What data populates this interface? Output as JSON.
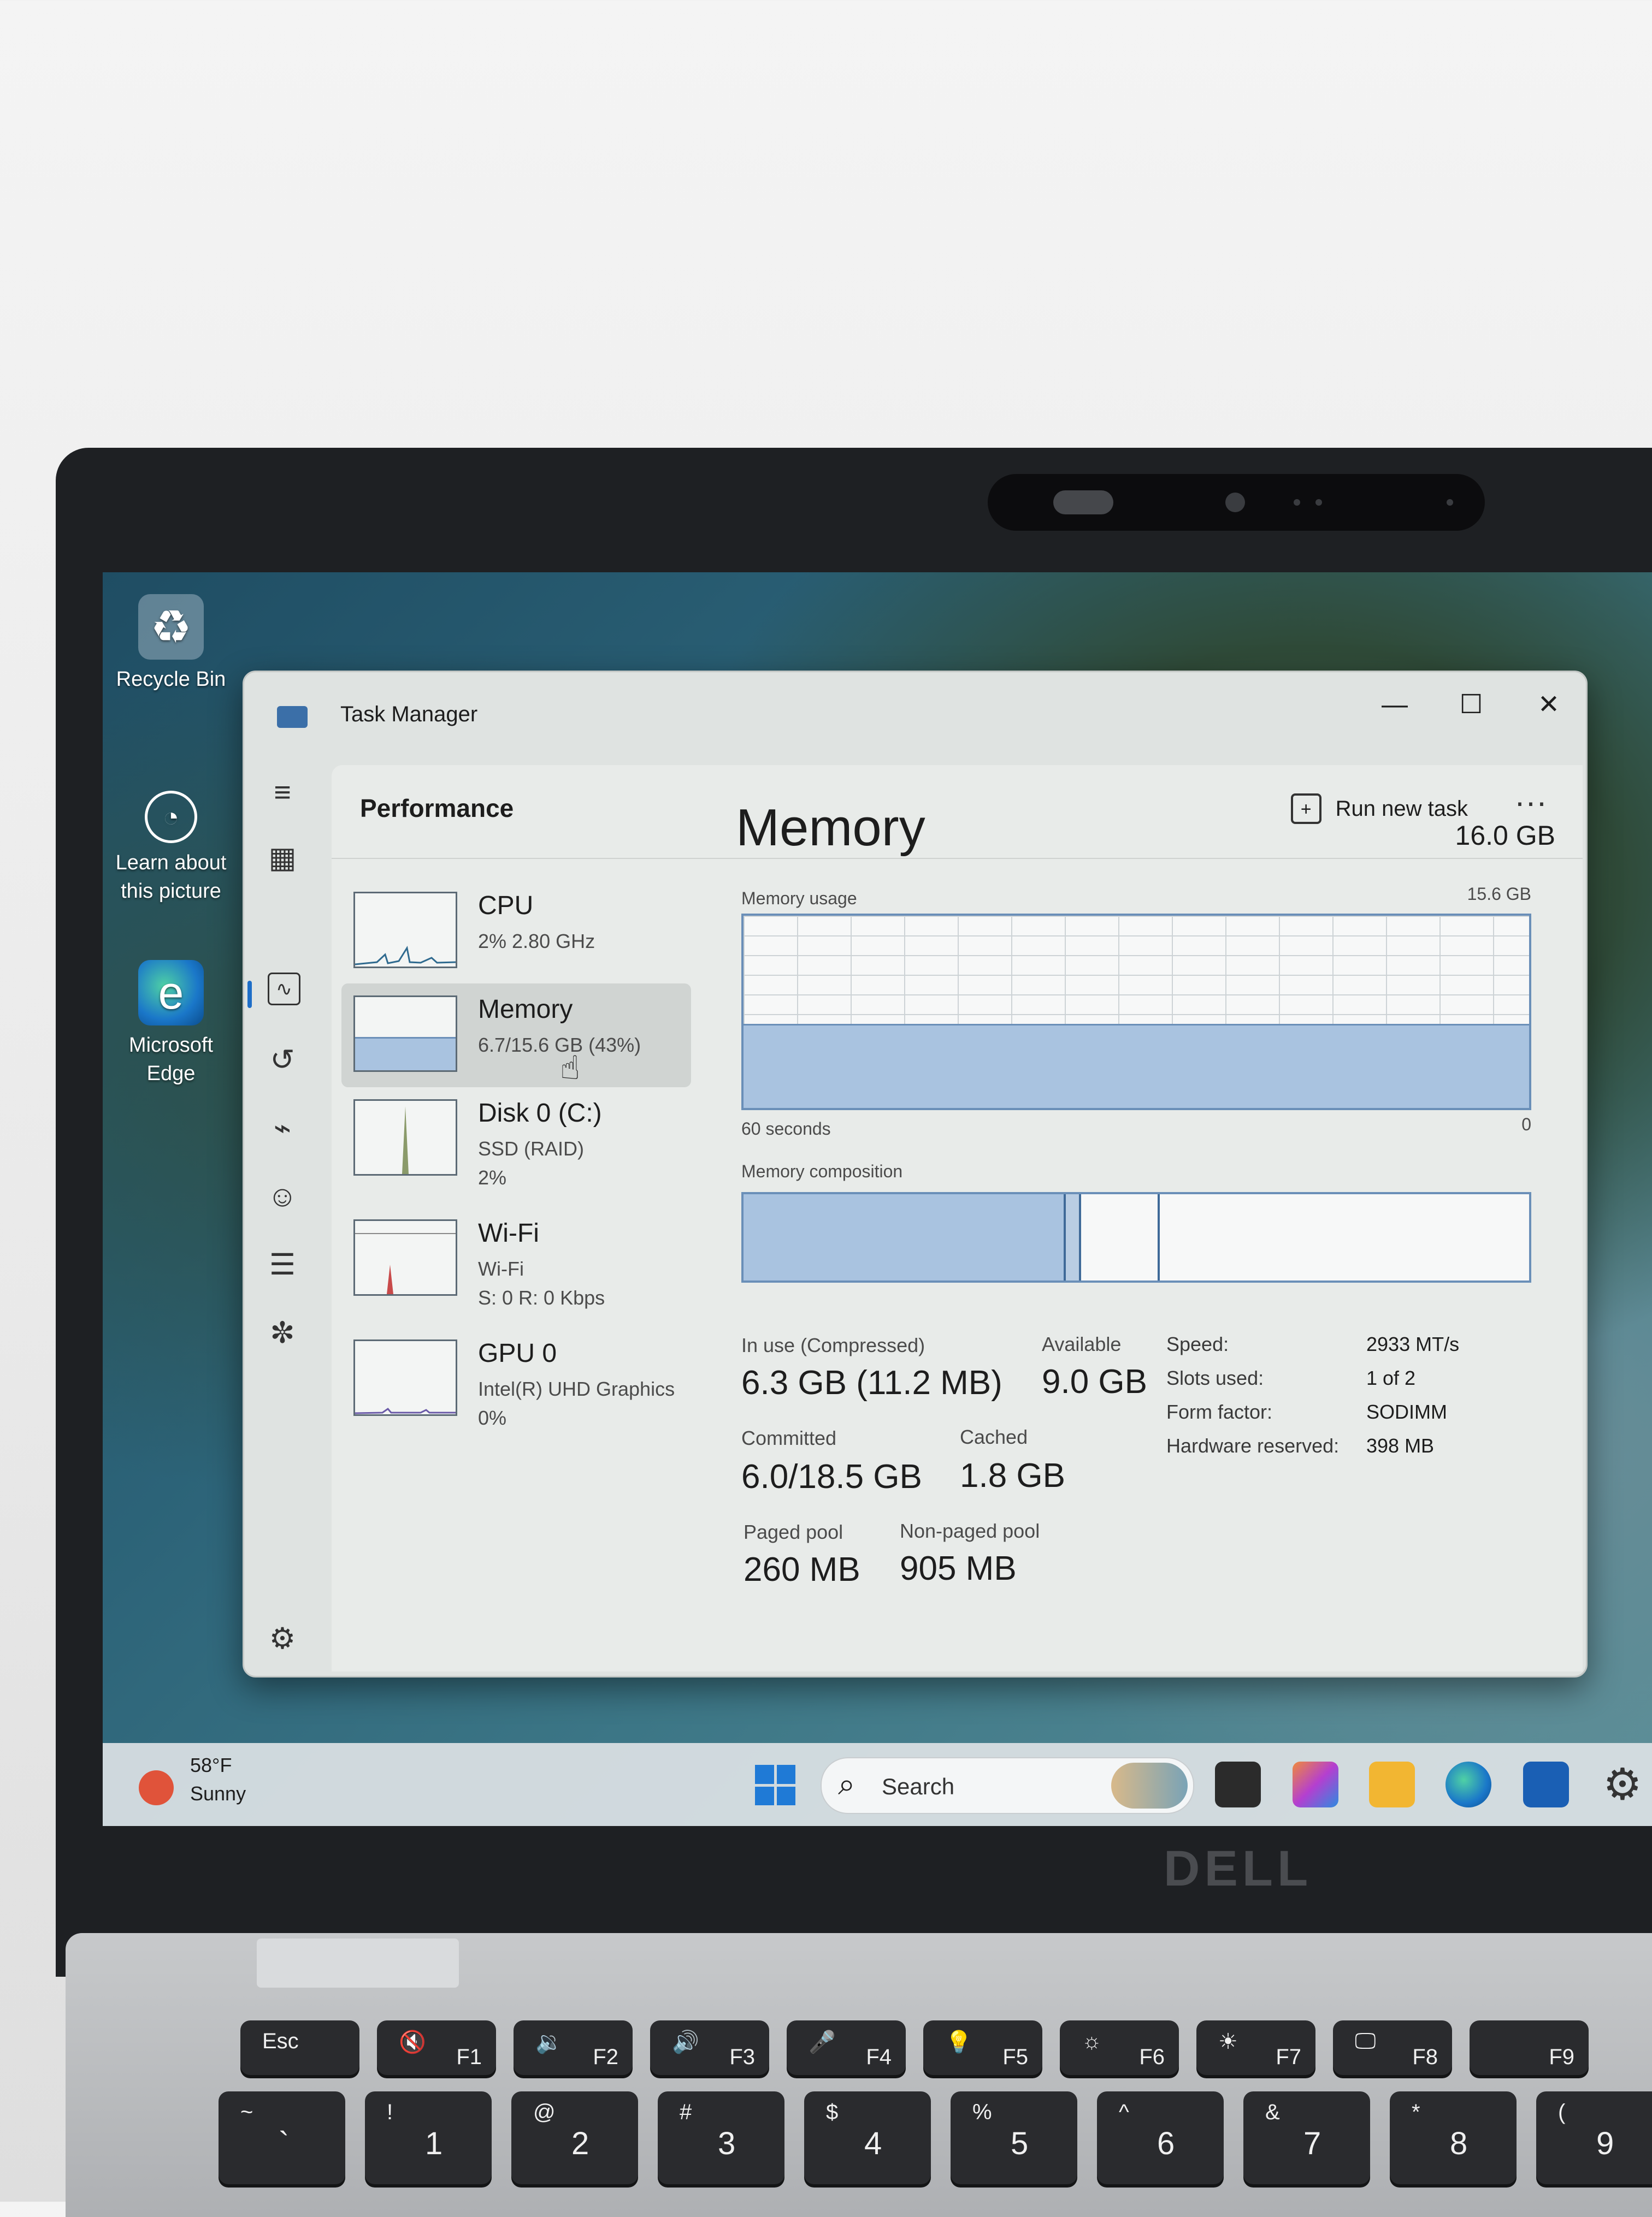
{
  "desktop": {
    "icons": [
      {
        "label": "Recycle Bin",
        "icon": "recycle-bin-icon"
      },
      {
        "label": "Learn about this picture",
        "icon": "camera-icon"
      },
      {
        "label": "Microsoft Edge",
        "icon": "edge-icon"
      }
    ]
  },
  "window": {
    "title": "Task Manager",
    "controls": {
      "minimize": "—",
      "maximize": "☐",
      "close": "✕"
    }
  },
  "header": {
    "page_title": "Performance",
    "run_new_task": "Run new task",
    "more": "···"
  },
  "devices": [
    {
      "name": "CPU",
      "sub1": "2%  2.80 GHz",
      "sub2": ""
    },
    {
      "name": "Memory",
      "sub1": "6.7/15.6 GB (43%)",
      "sub2": ""
    },
    {
      "name": "Disk 0 (C:)",
      "sub1": "SSD (RAID)",
      "sub2": "2%"
    },
    {
      "name": "Wi-Fi",
      "sub1": "Wi-Fi",
      "sub2": "S: 0  R: 0 Kbps"
    },
    {
      "name": "GPU 0",
      "sub1": "Intel(R) UHD Graphics",
      "sub2": "0%"
    }
  ],
  "memory": {
    "title": "Memory",
    "total": "16.0 GB",
    "usage_label": "Memory usage",
    "usage_max": "15.6 GB",
    "usage_fraction": 0.43,
    "time_span": "60 seconds",
    "time_end": "0",
    "composition_label": "Memory composition",
    "composition": {
      "in_use_fraction": 0.41,
      "modified_fraction": 0.02,
      "standby_fraction": 0.1
    },
    "stats": {
      "in_use_label": "In use (Compressed)",
      "in_use_value": "6.3 GB (11.2 MB)",
      "available_label": "Available",
      "available_value": "9.0 GB",
      "committed_label": "Committed",
      "committed_value": "6.0/18.5 GB",
      "cached_label": "Cached",
      "cached_value": "1.8 GB",
      "paged_label": "Paged pool",
      "paged_value": "260 MB",
      "nonpaged_label": "Non-paged pool",
      "nonpaged_value": "905 MB"
    },
    "specs": [
      {
        "label": "Speed:",
        "value": "2933 MT/s"
      },
      {
        "label": "Slots used:",
        "value": "1 of 2"
      },
      {
        "label": "Form factor:",
        "value": "SODIMM"
      },
      {
        "label": "Hardware reserved:",
        "value": "398 MB"
      }
    ]
  },
  "taskbar": {
    "weather_temp": "58°F",
    "weather_desc": "Sunny",
    "search_placeholder": "Search",
    "apps": [
      "windows-start-icon",
      "task-view-icon",
      "m365-copilot-icon",
      "file-explorer-icon",
      "edge-icon",
      "store-icon",
      "settings-icon"
    ]
  },
  "brand": "DELL",
  "keyboard": {
    "fn_row": [
      {
        "top": "Esc",
        "bottom": ""
      },
      {
        "top": "🔇",
        "bottom": "F1"
      },
      {
        "top": "🔉",
        "bottom": "F2"
      },
      {
        "top": "🔊",
        "bottom": "F3"
      },
      {
        "top": "🎤",
        "bottom": "F4"
      },
      {
        "top": "💡",
        "bottom": "F5"
      },
      {
        "top": "☼",
        "bottom": "F6"
      },
      {
        "top": "☀",
        "bottom": "F7"
      },
      {
        "top": "🖵",
        "bottom": "F8"
      },
      {
        "top": "",
        "bottom": "F9"
      }
    ],
    "num_row": [
      {
        "top": "~",
        "bottom": "`"
      },
      {
        "top": "!",
        "bottom": "1"
      },
      {
        "top": "@",
        "bottom": "2"
      },
      {
        "top": "#",
        "bottom": "3"
      },
      {
        "top": "$",
        "bottom": "4"
      },
      {
        "top": "%",
        "bottom": "5"
      },
      {
        "top": "^",
        "bottom": "6"
      },
      {
        "top": "&",
        "bottom": "7"
      },
      {
        "top": "*",
        "bottom": "8"
      },
      {
        "top": "(",
        "bottom": "9"
      }
    ]
  },
  "colors": {
    "accent": "#1e6ec8",
    "memory_fill": "#a9c3e0",
    "memory_border": "#6a8fb8"
  }
}
